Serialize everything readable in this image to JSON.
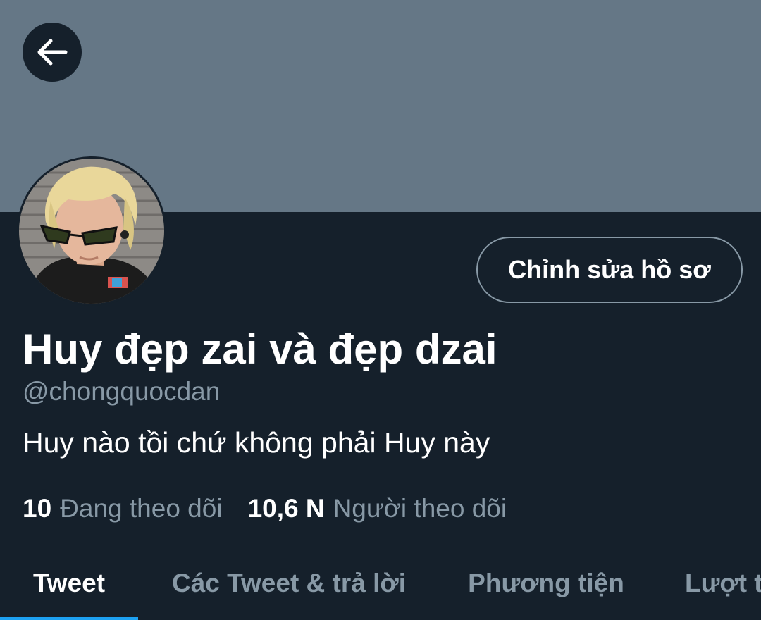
{
  "header": {
    "back_icon": "arrow-left-icon",
    "banner_color": "#657786"
  },
  "profile": {
    "edit_label": "Chỉnh sửa hồ sơ",
    "display_name": "Huy đẹp zai và đẹp dzai",
    "handle": "@chongquocdan",
    "bio": "Huy nào tồi chứ không phải Huy này"
  },
  "stats": {
    "following_count": "10",
    "following_label": "Đang theo dõi",
    "followers_count": "10,6 N",
    "followers_label": "Người theo dõi"
  },
  "tabs": [
    {
      "label": "Tweet",
      "active": true
    },
    {
      "label": "Các Tweet & trả lời",
      "active": false
    },
    {
      "label": "Phương tiện",
      "active": false
    },
    {
      "label": "Lượt thích",
      "active": false
    }
  ],
  "colors": {
    "background": "#15202b",
    "accent": "#1da1f2",
    "secondary_text": "#8899a6"
  }
}
